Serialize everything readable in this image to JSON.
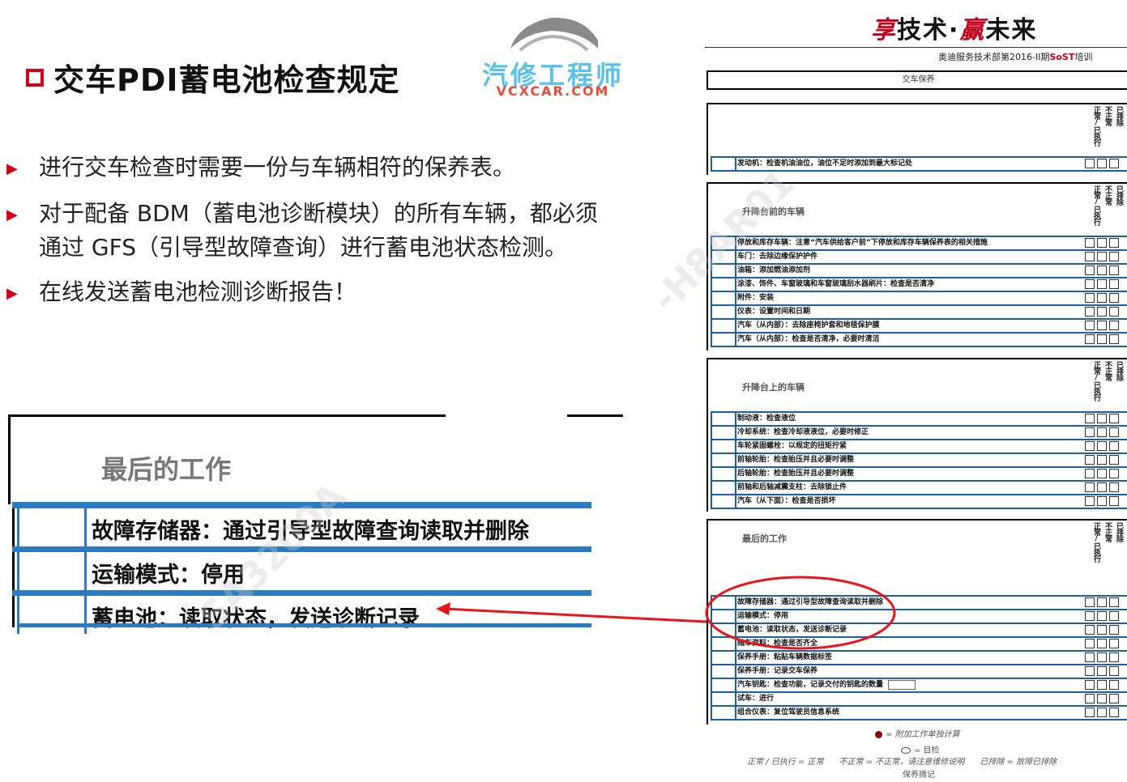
{
  "slide": {
    "title": "交车PDI蓄电池检查规定"
  },
  "logo": {
    "cn": "汽修工程师",
    "url": "VCXCAR.COM"
  },
  "watermark": {
    "a": "SA3200A",
    "b": "-H8AR01"
  },
  "bullets": [
    "进行交车检查时需要一份与车辆相符的保养表。",
    "对于配备 BDM（蓄电池诊断模块）的所有车辆，都必须\n通过 GFS（引导型故障查询）进行蓄电池状态检测。",
    "在线发送蓄电池检测诊断报告！"
  ],
  "zoom": {
    "title": "最后的工作",
    "rows": [
      "故障存储器：通过引导型故障查询读取并删除",
      "运输模式：停用",
      "蓄电池：读取状态，发送诊断记录"
    ]
  },
  "brand": {
    "slogan_a": "享",
    "slogan_b": "技术·",
    "slogan_c": "赢",
    "slogan_d": "未来",
    "sub_a": "奥迪服务技术部第2016-II期",
    "sub_b": "SoST",
    "sub_c": "培训"
  },
  "form": {
    "header": "交车保养",
    "col_headers": [
      "正常/已执行",
      "不正常",
      "已排除"
    ],
    "sections": [
      {
        "title": "",
        "rows": [
          "发动机：检查机油油位，油位不足时添加到最大标记处"
        ]
      },
      {
        "title": "升降台前的车辆",
        "rows": [
          "停放和库存车辆：注意“汽车供给客户前”下停放和库存车辆保养表的相关措施",
          "车门：去除边缘保护护件",
          "油箱：添加燃油添加剂",
          "涂漆、饰件、车窗玻璃和车窗玻璃刮水器刷片：检查是否清净",
          "附件：安装",
          "仪表：设置时间和日期",
          "汽车（从内部）：去除座椅护套和地毯保护膜",
          "汽车（从内部）：检查是否清净，必要时清洁"
        ]
      },
      {
        "title": "升降台上的车辆",
        "rows": [
          "制动液：检查液位",
          "冷却系统：检查冷却液液位，必要时修正",
          "车轮紧固螺栓：以规定的扭矩拧紧",
          "前轴轮胎：检查胎压并且必要时调整",
          "后轴轮胎：检查胎压并且必要时调整",
          "前轴和后轴减震支柱：去除锁止件",
          "汽车（从下面）：检查是否损坏"
        ]
      },
      {
        "title": "最后的工作",
        "rows": [
          "故障存储器：通过引导型故障查询读取并删除",
          "运输模式：停用",
          "蓄电池：读取状态，发送诊断记录",
          "随车资料：检查是否齐全",
          "保养手册：粘贴车辆数据标签",
          "保养手册：记录交车保养",
          "汽车钥匙：检查功能，记录交付的钥匙的数量",
          "试车：进行",
          "组合仪表：复位驾驶员信息系统"
        ]
      }
    ],
    "legend": {
      "line1": "= 附加工作单独计算",
      "line2": "= 目检",
      "line3": "正常 / 已执行 = 正常      不正常 = 不正常，请注意维修说明      已排除 = 故障已排除",
      "line4": "保养摘记"
    }
  },
  "colors": {
    "accent_red": "#d0021b",
    "table_blue": "#2a7bbf",
    "highlight_red": "#e8141b"
  }
}
